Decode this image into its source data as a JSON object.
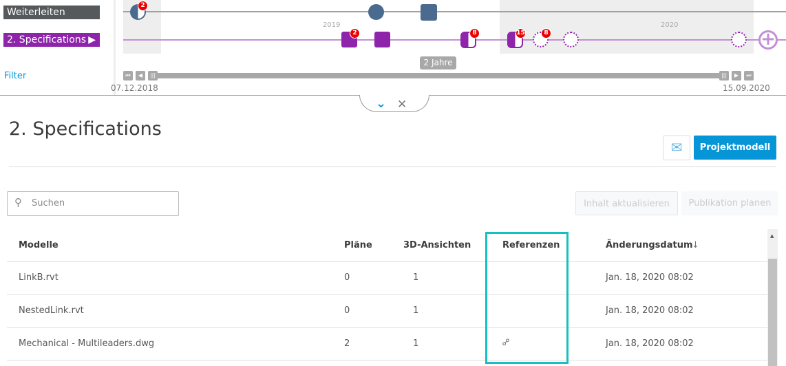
{
  "timeline": {
    "lanes": [
      {
        "label": "Weiterleiten",
        "color": "#55595c"
      },
      {
        "label": "2. Specifications",
        "color": "#8e24aa"
      }
    ],
    "filter_label": "Filter",
    "years": [
      "2019",
      "2020"
    ],
    "badges": {
      "w1": "2",
      "s1": "2",
      "s3": "8",
      "s4": "15",
      "s5": "8"
    },
    "range_label": "2 Jahre",
    "start_date": "07.12.2018",
    "end_date": "15.09.2020"
  },
  "header": {
    "title": "2. Specifications",
    "project_model_label": "Projektmodell"
  },
  "toolbar": {
    "search_placeholder": "Suchen",
    "update_label": "Inhalt aktualisieren",
    "publish_label": "Publikation planen"
  },
  "table": {
    "columns": [
      "Modelle",
      "Pläne",
      "3D-Ansichten",
      "Referenzen",
      "Änderungsdatum"
    ],
    "sort_indicator": "↓",
    "rows": [
      {
        "name": "LinkB.rvt",
        "plans": "0",
        "views": "1",
        "ref": false,
        "date": "Jan. 18, 2020 08:02"
      },
      {
        "name": "NestedLink.rvt",
        "plans": "0",
        "views": "1",
        "ref": false,
        "date": "Jan. 18, 2020 08:02"
      },
      {
        "name": "Mechanical - Multileaders.dwg",
        "plans": "2",
        "views": "1",
        "ref": true,
        "date": "Jan. 18, 2020 08:02"
      }
    ]
  },
  "colors": {
    "accent": "#0696d7",
    "highlight": "#14c0c0",
    "purple": "#8e24aa",
    "blue_marker": "#4a6a8f"
  }
}
